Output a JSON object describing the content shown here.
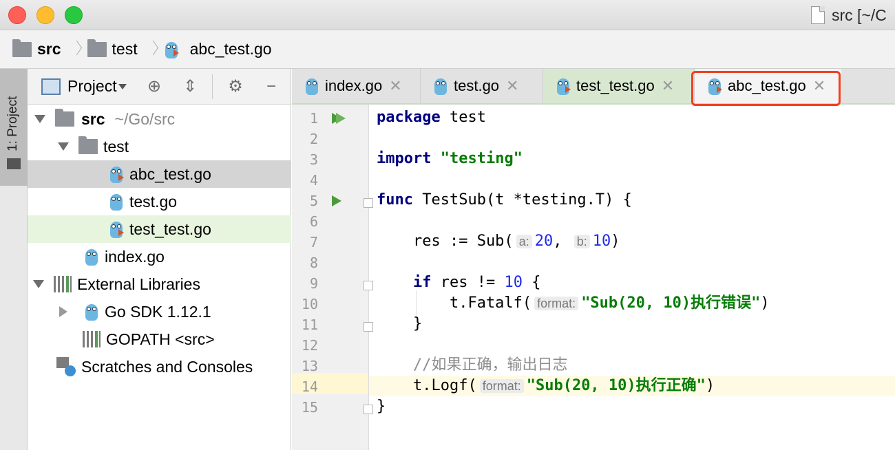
{
  "window": {
    "title": "src [~/C"
  },
  "colors": {
    "close": "#fe5f57",
    "minimize": "#febc2e",
    "maximize": "#28c840",
    "highlight": "#ef4021"
  },
  "breadcrumb": [
    "src",
    "test",
    "abc_test.go"
  ],
  "toolwindow": {
    "label": "1: Project"
  },
  "project": {
    "header": "Project",
    "icons": [
      "locate-icon",
      "collapse-icon",
      "gear-icon",
      "hide-icon"
    ],
    "tree": {
      "src": {
        "name": "src",
        "path": "~/Go/src"
      },
      "test": "test",
      "abc_test": "abc_test.go",
      "test_go": "test.go",
      "test_test": "test_test.go",
      "index": "index.go",
      "external": "External Libraries",
      "gosdk": "Go SDK 1.12.1",
      "gopath": "GOPATH <src>",
      "scratches": "Scratches and Consoles"
    }
  },
  "tabs": [
    {
      "label": "index.go"
    },
    {
      "label": "test.go"
    },
    {
      "label": "test_test.go"
    },
    {
      "label": "abc_test.go",
      "active": true
    }
  ],
  "code": {
    "line_numbers": [
      "1",
      "2",
      "3",
      "4",
      "5",
      "6",
      "7",
      "8",
      "9",
      "10",
      "11",
      "12",
      "13",
      "14",
      "15"
    ],
    "l1_kw": "package",
    "l1_rest": " test",
    "l3_kw": "import",
    "l3_str": "\"testing\"",
    "l5_kw": "func",
    "l5_rest": " TestSub(t *testing.T) {",
    "l7_pre": "    res := Sub(",
    "l7_hint_a": "a:",
    "l7_num_a": "20",
    "l7_mid": ",",
    "l7_hint_b": "b:",
    "l7_num_b": "10",
    "l7_end": ")",
    "l9_kw": "if",
    "l9_mid": " res != ",
    "l9_num": "10",
    "l9_end": " {",
    "l10_pre": "        t.Fatalf(",
    "l10_hint": "format:",
    "l10_str": "\"Sub(20, 10)执行错误\"",
    "l10_end": ")",
    "l11": "    }",
    "l13_comment": "    //如果正确，输出日志",
    "l14_pre": "    t.Logf(",
    "l14_hint": "format:",
    "l14_str": "\"Sub(20, 10)执行正确\"",
    "l14_end": ")",
    "l15": "}"
  }
}
